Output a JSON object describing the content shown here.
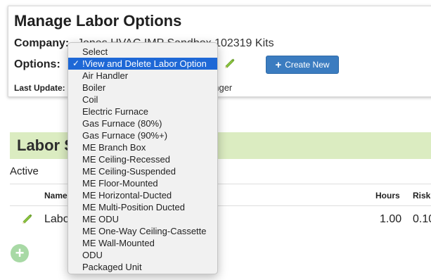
{
  "panel": {
    "title": "Manage Labor Options",
    "company_label": "Company:",
    "company_value": "Jones HVAC IMP Sandbox 102319 Kits",
    "options_label": "Options:",
    "create_button": "Create New",
    "last_update_label": "Last Update:",
    "last_update_value": "etzinger"
  },
  "dropdown": {
    "items": [
      "Select",
      "!View and Delete Labor Option",
      "Air Handler",
      "Boiler",
      "Coil",
      "Electric Furnace",
      "Gas Furnace (80%)",
      "Gas Furnace (90%+)",
      "ME Branch Box",
      "ME Ceiling-Recessed",
      "ME Ceiling-Suspended",
      "ME Floor-Mounted",
      "ME Horizontal-Ducted",
      "ME Multi-Position Ducted",
      "ME ODU",
      "ME One-Way Ceiling-Cassette",
      "ME Wall-Mounted",
      "ODU",
      "Packaged Unit"
    ],
    "selected_index": 1,
    "check_mark": "✓"
  },
  "section": {
    "title": "Labor S",
    "active_label": "Active"
  },
  "table": {
    "headers": {
      "name": "Name",
      "hours": "Hours",
      "risk": "Risk"
    },
    "rows": [
      {
        "name": "Labo",
        "hours": "1.00",
        "risk": "0.10"
      }
    ]
  },
  "colors": {
    "accent": "#3b7cc0",
    "banner": "#dbecc1",
    "selected": "#1e68d6",
    "add_button": "#a8d9a5"
  }
}
